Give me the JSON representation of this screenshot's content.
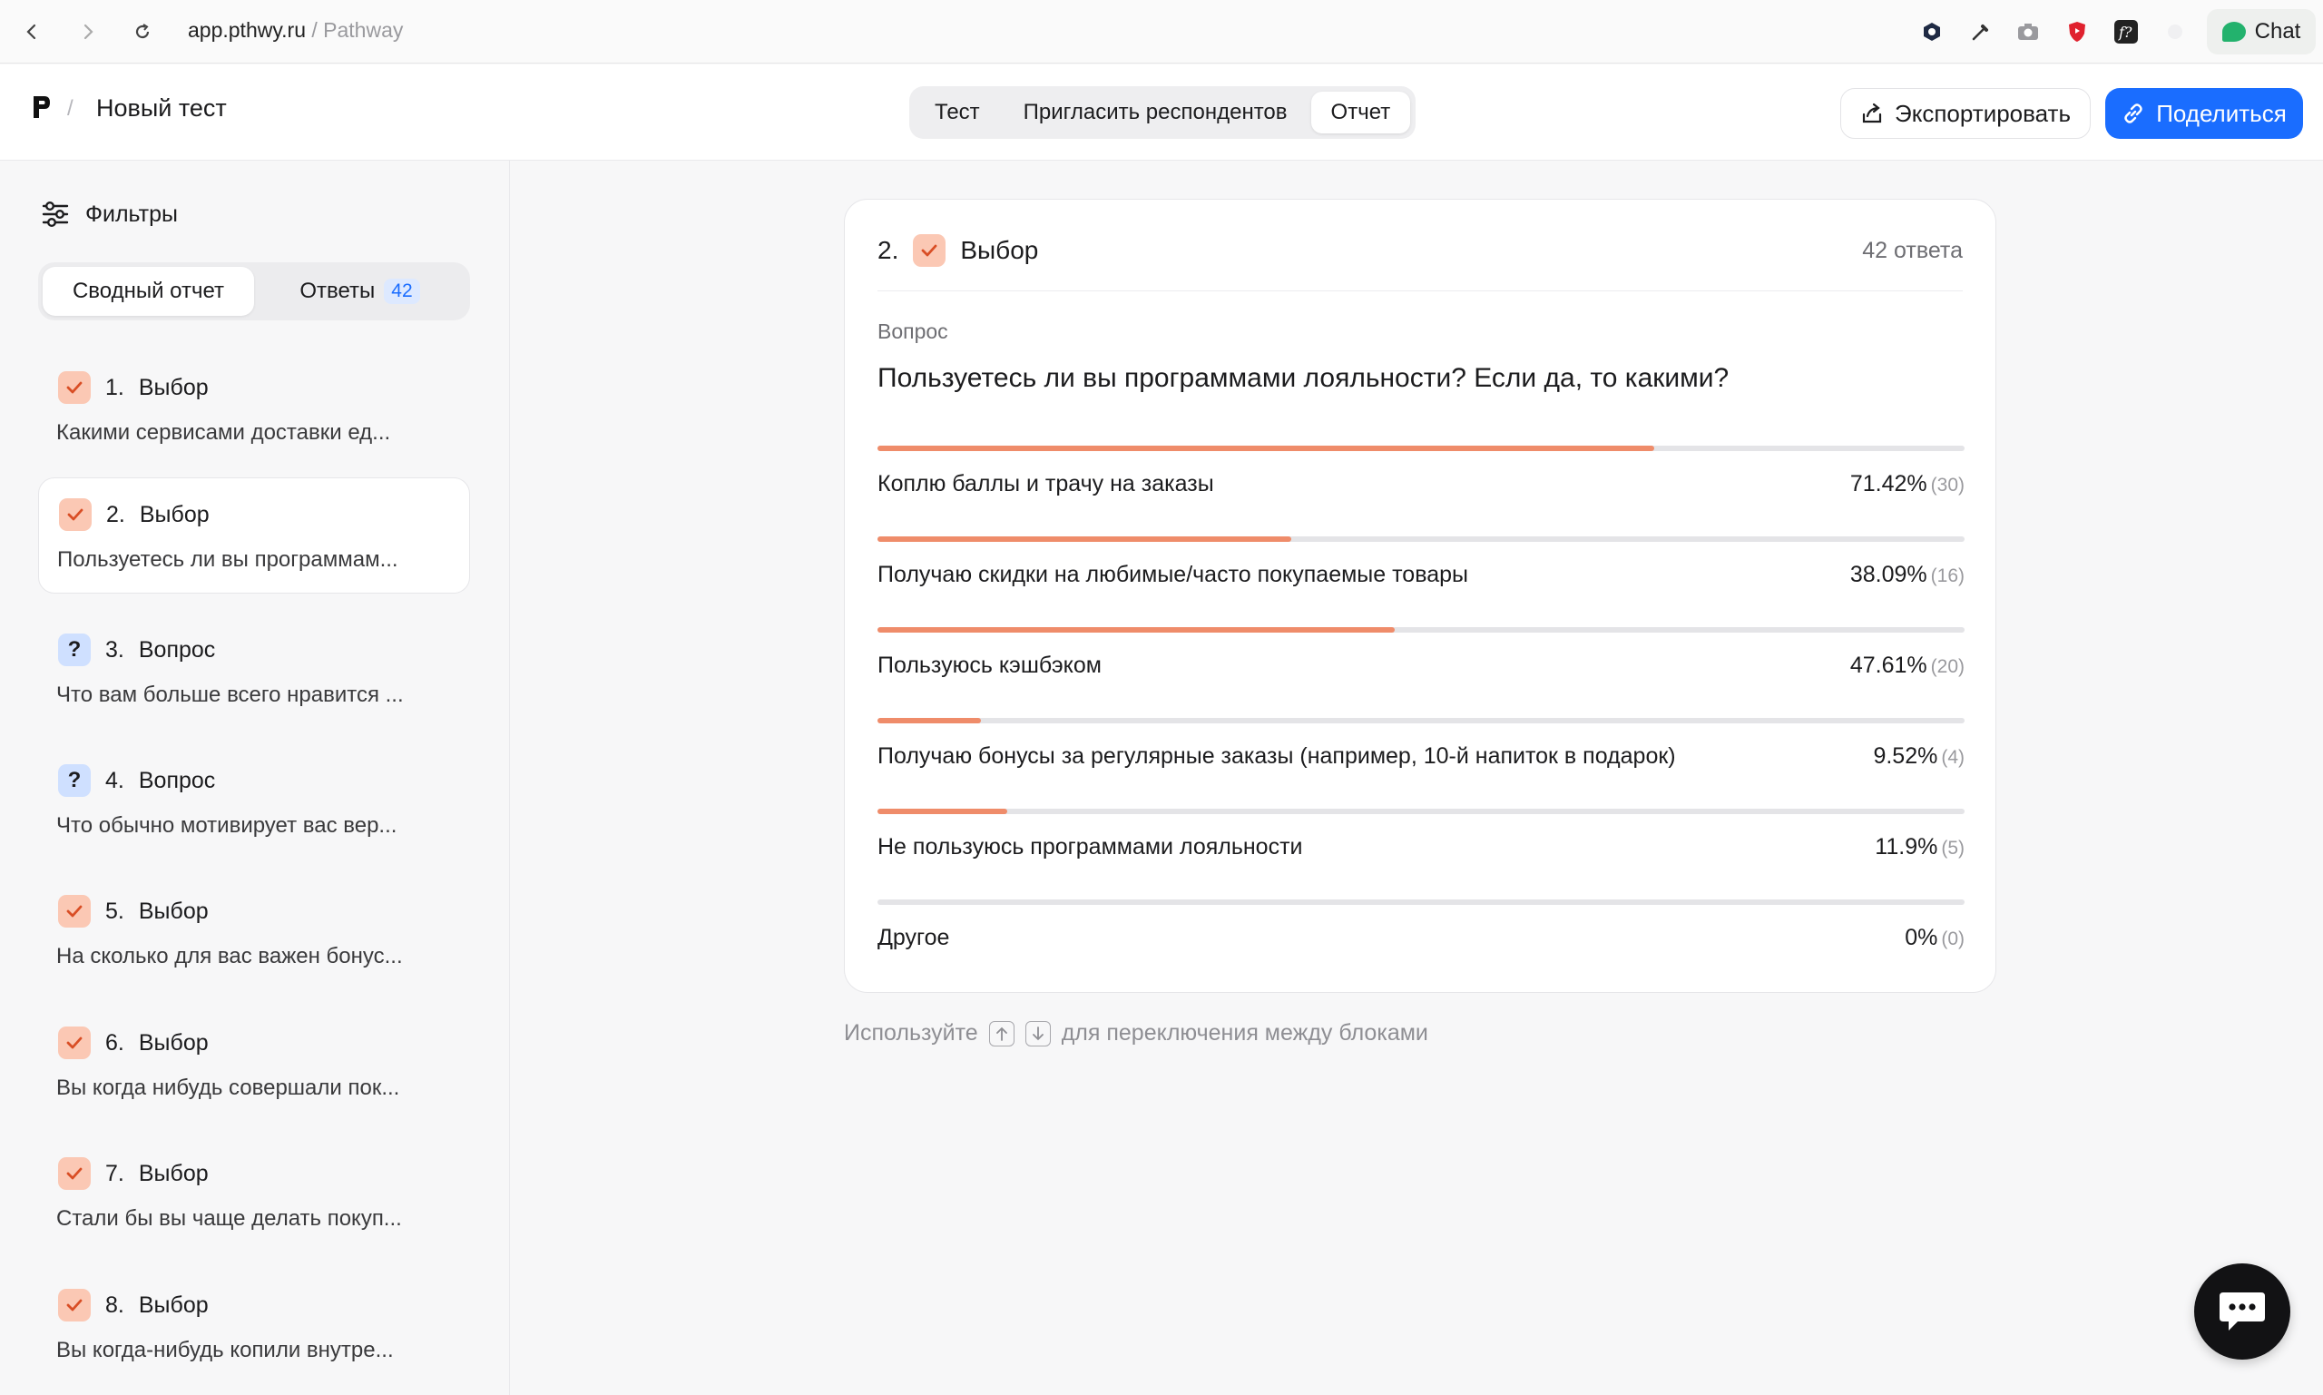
{
  "browser": {
    "url_host": "app.pthwy.ru",
    "url_sep": " / ",
    "url_site": "Pathway",
    "chat_label": "Chat"
  },
  "header": {
    "project_title": "Новый тест",
    "tabs": [
      {
        "label": "Тест",
        "active": false
      },
      {
        "label": "Пригласить респондентов",
        "active": false
      },
      {
        "label": "Отчет",
        "active": true
      }
    ],
    "export_label": "Экспортировать",
    "share_label": "Поделиться"
  },
  "sidebar": {
    "filters_label": "Фильтры",
    "segments": {
      "summary": "Сводный отчет",
      "answers": "Ответы",
      "answers_count": "42"
    },
    "items": [
      {
        "num": "1.",
        "type": "Выбор",
        "icon": "check-icon",
        "text": "Какими сервисами доставки ед..."
      },
      {
        "num": "2.",
        "type": "Выбор",
        "icon": "check-icon",
        "text": "Пользуетесь ли вы программам...",
        "active": true
      },
      {
        "num": "3.",
        "type": "Вопрос",
        "icon": "question-icon",
        "text": "Что вам больше всего нравится ..."
      },
      {
        "num": "4.",
        "type": "Вопрос",
        "icon": "question-icon",
        "text": "Что обычно мотивирует вас вер..."
      },
      {
        "num": "5.",
        "type": "Выбор",
        "icon": "check-icon",
        "text": "На сколько для вас важен бонус..."
      },
      {
        "num": "6.",
        "type": "Выбор",
        "icon": "check-icon",
        "text": "Вы когда нибудь совершали пок..."
      },
      {
        "num": "7.",
        "type": "Выбор",
        "icon": "check-icon",
        "text": "Стали бы вы чаще делать покуп..."
      },
      {
        "num": "8.",
        "type": "Выбор",
        "icon": "check-icon",
        "text": "Вы когда-нибудь копили внутре..."
      }
    ]
  },
  "card": {
    "num": "2.",
    "type": "Выбор",
    "answers_count": "42 ответа",
    "question_label": "Вопрос",
    "question_text": "Пользуетесь ли вы программами лояльности? Если да, то какими?",
    "options": [
      {
        "text": "Коплю баллы и трачу на заказы",
        "percent": "71.42%",
        "count": "(30)",
        "fraction": 0.7142
      },
      {
        "text": "Получаю скидки на любимые/часто покупаемые товары",
        "percent": "38.09%",
        "count": "(16)",
        "fraction": 0.3809
      },
      {
        "text": "Пользуюсь кэшбэком",
        "percent": "47.61%",
        "count": "(20)",
        "fraction": 0.4761
      },
      {
        "text": "Получаю бонусы за регулярные заказы (например, 10-й напиток в подарок)",
        "percent": "9.52%",
        "count": "(4)",
        "fraction": 0.0952
      },
      {
        "text": "Не пользуюсь программами лояльности",
        "percent": "11.9%",
        "count": "(5)",
        "fraction": 0.119
      },
      {
        "text": "Другое",
        "percent": "0%",
        "count": "(0)",
        "fraction": 0
      }
    ]
  },
  "hint": {
    "before": "Используйте",
    "after": "для переключения между блоками"
  },
  "colors": {
    "accent": "#1a6dff",
    "bar_fill": "#ef8c6a",
    "check_bg": "#fbc8b4",
    "question_bg": "#cfe0ff"
  }
}
